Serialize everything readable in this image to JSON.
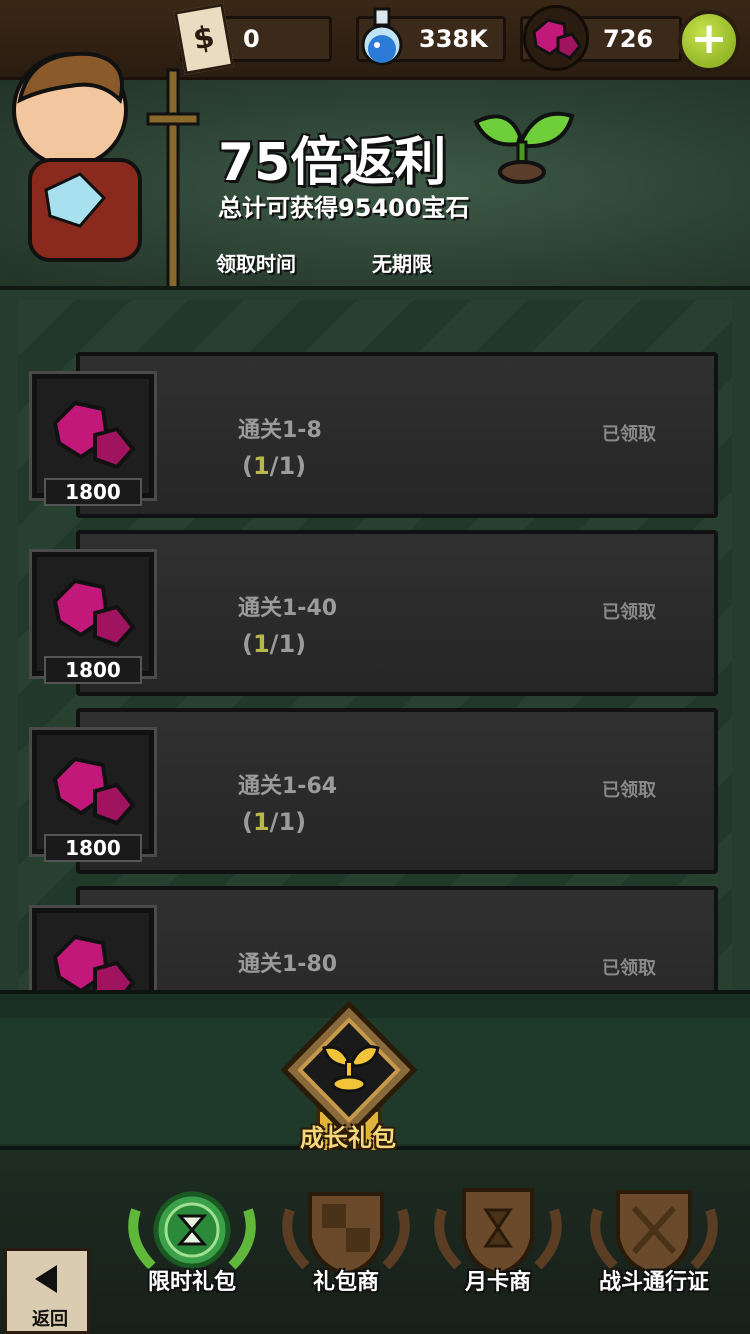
{
  "currency": {
    "tickets": "0",
    "potion": "338K",
    "gems": "726",
    "add_label": "+"
  },
  "header": {
    "title": "75倍返利",
    "subtitle": "总计可获得95400宝石",
    "claim_time_label": "领取时间",
    "claim_time_value": "无期限"
  },
  "rewards": [
    {
      "amount": "1800",
      "title": "通关1-8",
      "progress_open": "(",
      "progress_cur": "1",
      "progress_rest": "/1)",
      "status": "已领取"
    },
    {
      "amount": "1800",
      "title": "通关1-40",
      "progress_open": "(",
      "progress_cur": "1",
      "progress_rest": "/1)",
      "status": "已领取"
    },
    {
      "amount": "1800",
      "title": "通关1-64",
      "progress_open": "(",
      "progress_cur": "1",
      "progress_rest": "/1)",
      "status": "已领取"
    },
    {
      "amount": "",
      "title": "通关1-80",
      "progress_open": "",
      "progress_cur": "",
      "progress_rest": "",
      "status": "已领取"
    }
  ],
  "growth_pack": {
    "label": "成长礼包"
  },
  "nav": {
    "limited": "限时礼包",
    "shop": "礼包商",
    "monthly": "月卡商",
    "battle_pass": "战斗通行证"
  },
  "back": {
    "label": "返回"
  },
  "colors": {
    "accent_green": "#7ea51a",
    "gem": "#c2187a",
    "gold": "#f6d77a"
  }
}
